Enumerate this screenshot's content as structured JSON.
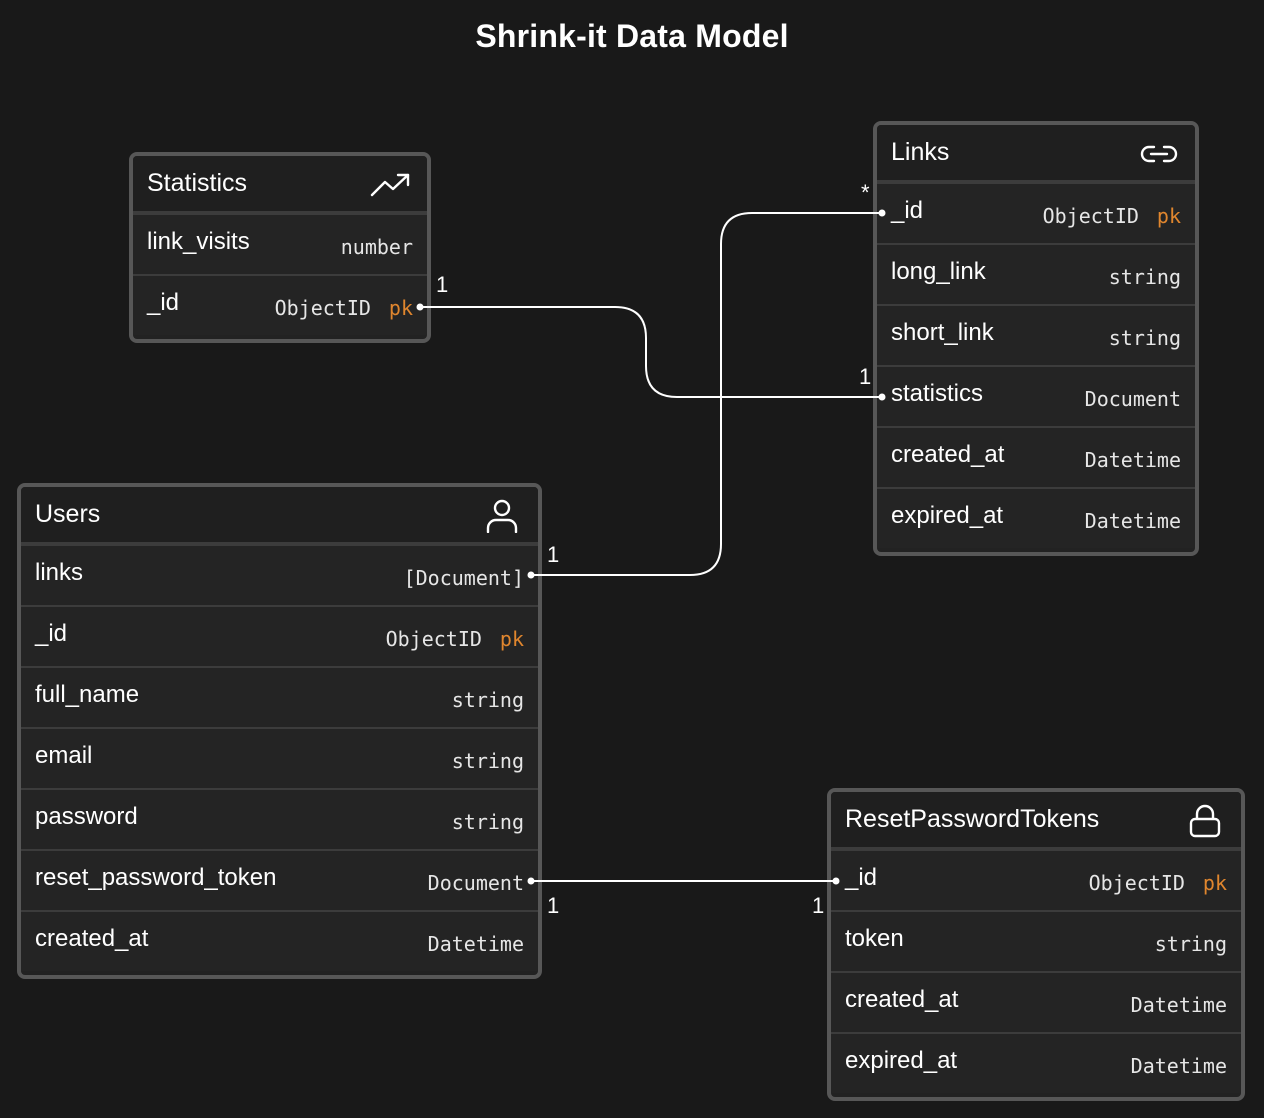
{
  "title": "Shrink-it Data Model",
  "entities": {
    "statistics": {
      "name": "Statistics",
      "icon": "trending-up-icon",
      "fields": [
        {
          "name": "link_visits",
          "type": "number"
        },
        {
          "name": "_id",
          "type": "ObjectID",
          "key": "pk"
        }
      ]
    },
    "links": {
      "name": "Links",
      "icon": "link-icon",
      "fields": [
        {
          "name": "_id",
          "type": "ObjectID",
          "key": "pk"
        },
        {
          "name": "long_link",
          "type": "string"
        },
        {
          "name": "short_link",
          "type": "string"
        },
        {
          "name": "statistics",
          "type": "Document"
        },
        {
          "name": "created_at",
          "type": "Datetime"
        },
        {
          "name": "expired_at",
          "type": "Datetime"
        }
      ]
    },
    "users": {
      "name": "Users",
      "icon": "user-icon",
      "fields": [
        {
          "name": "links",
          "type": "[Document]"
        },
        {
          "name": "_id",
          "type": "ObjectID",
          "key": "pk"
        },
        {
          "name": "full_name",
          "type": "string"
        },
        {
          "name": "email",
          "type": "string"
        },
        {
          "name": "password",
          "type": "string"
        },
        {
          "name": "reset_password_token",
          "type": "Document"
        },
        {
          "name": "created_at",
          "type": "Datetime"
        }
      ]
    },
    "reset_tokens": {
      "name": "ResetPasswordTokens",
      "icon": "lock-icon",
      "fields": [
        {
          "name": "_id",
          "type": "ObjectID",
          "key": "pk"
        },
        {
          "name": "token",
          "type": "string"
        },
        {
          "name": "created_at",
          "type": "Datetime"
        },
        {
          "name": "expired_at",
          "type": "Datetime"
        }
      ]
    }
  },
  "relations": [
    {
      "from": "statistics._id",
      "to": "links.statistics",
      "from_card": "1",
      "to_card": "1"
    },
    {
      "from": "users.links",
      "to": "links._id",
      "from_card": "1",
      "to_card": "*"
    },
    {
      "from": "users.reset_password_token",
      "to": "reset_tokens._id",
      "from_card": "1",
      "to_card": "1"
    }
  ],
  "colors": {
    "background": "#191919",
    "border": "#575757",
    "pk": "#e0862e",
    "line": "#ffffff"
  }
}
